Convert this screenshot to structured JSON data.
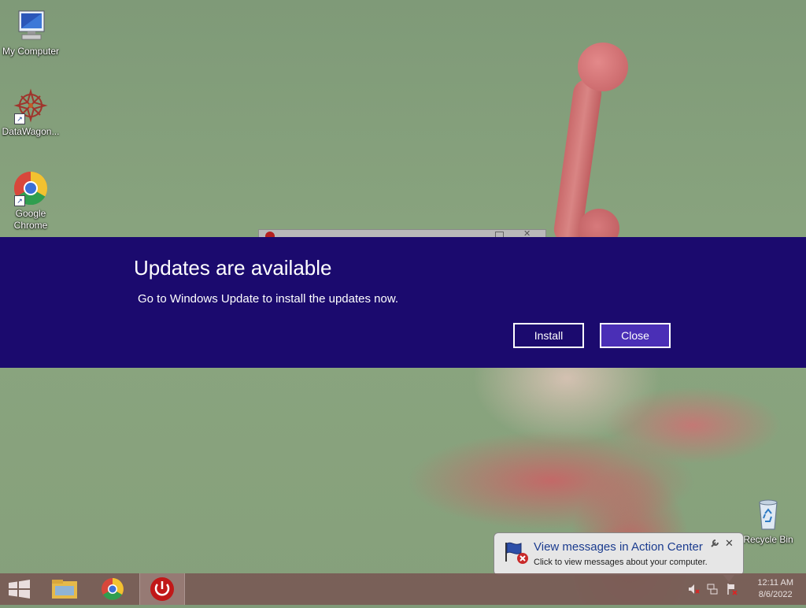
{
  "desktop": {
    "icons": [
      {
        "label": "My Computer",
        "icon": "computer-icon"
      },
      {
        "label": "DataWagon...",
        "icon": "datawagon-icon"
      },
      {
        "label": "Google Chrome",
        "icon": "chrome-icon"
      },
      {
        "label": "Recycle Bin",
        "icon": "recycle-bin-icon"
      }
    ]
  },
  "update_banner": {
    "title": "Updates are available",
    "message": "Go to Windows Update to install the updates now.",
    "install_label": "Install",
    "close_label": "Close"
  },
  "action_center": {
    "heading": "View messages in Action Center",
    "subtext": "Click to view messages about your computer."
  },
  "taskbar": {
    "buttons": [
      "start-icon",
      "file-explorer-icon",
      "chrome-icon",
      "power-app-icon"
    ],
    "tray_icons": [
      "volume-muted-icon",
      "network-icon",
      "action-center-flag-icon"
    ],
    "time": "12:11 AM",
    "date": "8/6/2022"
  },
  "colors": {
    "banner_bg": "#1b0a6e",
    "close_button_bg": "#4a2fb6",
    "balloon_heading": "#1b3c8f"
  }
}
